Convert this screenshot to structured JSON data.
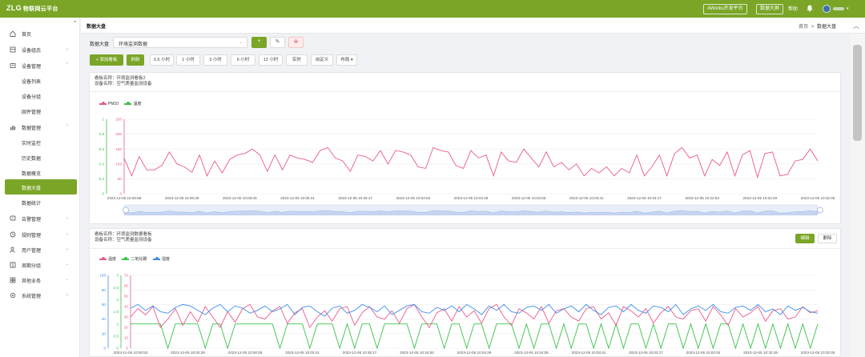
{
  "header": {
    "logo": "ZLG",
    "app_name": "物联网云平台",
    "dev_platform_btn": "AWorks开发平台",
    "big_screen_btn": "数据大屏",
    "help": "帮助"
  },
  "sidebar": {
    "items": [
      {
        "label": "首页",
        "icon": "home-icon"
      },
      {
        "label": "设备组态",
        "icon": "config-icon",
        "chevron": "⌄"
      },
      {
        "label": "设备管理",
        "icon": "device-icon",
        "chevron": "⌃"
      },
      {
        "label": "设备列表"
      },
      {
        "label": "设备分组"
      },
      {
        "label": "固件管理"
      },
      {
        "label": "数据管理",
        "icon": "bar-chart-icon",
        "chevron": "⌃"
      },
      {
        "label": "实时监控"
      },
      {
        "label": "历史数据"
      },
      {
        "label": "数据概览"
      },
      {
        "label": "数据大盘",
        "active": true
      },
      {
        "label": "数据统计"
      },
      {
        "label": "告警管理",
        "icon": "alarm-icon",
        "chevron": "⌄"
      },
      {
        "label": "规则管理",
        "icon": "clock-icon",
        "chevron": "⌄"
      },
      {
        "label": "用户管理",
        "icon": "user-icon",
        "chevron": "⌄"
      },
      {
        "label": "周期分组",
        "icon": "group-icon",
        "chevron": "⌄"
      },
      {
        "label": "其他业务",
        "icon": "app-icon",
        "chevron": "⌄"
      },
      {
        "label": "系统管理",
        "icon": "gear-icon",
        "chevron": "⌄"
      }
    ]
  },
  "page": {
    "title": "数据大盘",
    "breadcrumb_home": "首页",
    "breadcrumb_sep": ">",
    "breadcrumb_current": "数据大盘"
  },
  "toolbar": {
    "board_label": "数据大盘",
    "board_value": "环境监测数据",
    "add_btn": "+",
    "edit_btn": "✎",
    "delete_btn": "⊗",
    "add_chart_btn": "+ 添加看板",
    "refresh_btn": "刷新",
    "ranges": [
      "0.5 小时",
      "1 小时",
      "3 小时",
      "6 小时",
      "12 小时",
      "实时",
      "自定义",
      "布局 ▾"
    ]
  },
  "cards": [
    {
      "name_line": "看板名称：环境监测看板2",
      "group_line": "设备名称：空气质量监测设备",
      "chart_data": {
        "type": "line",
        "series": [
          {
            "name": "PM10",
            "color": "#e85a8b"
          },
          {
            "name": "温度",
            "color": "#38c24a"
          }
        ],
        "y_left": {
          "ticks": [
            "0",
            "0.2",
            "0.4",
            "0.6",
            "0.8",
            "1"
          ],
          "color": "#38c24a"
        },
        "y_inner": {
          "ticks": [
            "0",
            "50",
            "100",
            "150",
            "200",
            "250"
          ],
          "color": "#e85a8b"
        },
        "x_ticks": [
          "2023-12-05 10:00:58",
          "2023-12-05 10:00:29",
          "2023-12-05 10:06:05",
          "2023-12-05 10:05:41",
          "2023-12-05 10:25:17",
          "2023-12-05 10:04:53",
          "2023-12-05 10:04:29",
          "2023-12-05 10:04:05",
          "2023-12-05 10:03:41",
          "2023-12-05 10:03:17",
          "2023-12-05 10:22:53",
          "2023-12-05 10:32:29",
          "2023-12-05 10:32:05"
        ],
        "pm10_values": [
          120,
          60,
          125,
          80,
          80,
          95,
          140,
          100,
          90,
          72,
          130,
          60,
          110,
          70,
          115,
          130,
          135,
          150,
          130,
          75,
          130,
          80,
          130,
          120,
          115,
          105,
          145,
          155,
          120,
          110,
          75,
          130,
          125,
          110,
          145,
          100,
          145,
          140,
          130,
          90,
          85,
          155,
          145,
          140,
          95,
          85,
          145,
          120,
          130,
          60,
          140,
          110,
          105,
          150,
          120,
          90,
          140,
          90,
          105,
          80,
          100,
          60,
          85,
          70,
          90,
          60,
          85,
          70,
          130,
          60,
          90,
          130,
          60,
          135,
          155,
          120,
          130,
          60,
          115,
          95,
          140,
          60,
          130,
          145,
          55,
          135,
          140,
          60,
          65,
          110,
          115,
          150,
          110
        ]
      }
    },
    {
      "name_line": "看板名称：环境监测数据看板",
      "group_line": "设备名称：空气质量监测设备",
      "edit_label": "编辑",
      "delete_label": "删除",
      "chart_data": {
        "type": "line",
        "series": [
          {
            "name": "温度",
            "color": "#e85a8b"
          },
          {
            "name": "二氧化碳",
            "color": "#38c24a"
          },
          {
            "name": "湿度",
            "color": "#3e8ee8"
          }
        ],
        "y_left": {
          "ticks": [
            "0",
            "20",
            "40",
            "60",
            "80",
            "100"
          ],
          "color": "#3e8ee8"
        },
        "y_mid": {
          "ticks": [
            "0",
            "0.5",
            "1",
            "1.5",
            "2",
            "2.5",
            "3"
          ],
          "color": "#38c24a"
        },
        "y_inner": {
          "ticks": [
            "0",
            "10",
            "20",
            "30",
            "40",
            "50",
            "60",
            "70"
          ],
          "color": "#e85a8b"
        },
        "x_ticks": [
          "2023-12-05 10:00:53",
          "2023-12-05 10:00:29",
          "2023-12-05 10:00:05",
          "2023-12-05 10:03:41",
          "2023-12-05 10:35:17",
          "2023-12-05 10:34:53",
          "2023-12-05 10:04:29",
          "2023-12-05 10:04:05",
          "2023-12-05 10:03:41",
          "2023-12-05 10:03:17",
          "2023-12-05 10:02:53",
          "2023-12-05 10:32:29",
          "2023-12-05 10:32:05"
        ],
        "temp_values": [
          30,
          38,
          32,
          40,
          20,
          28,
          38,
          22,
          35,
          25,
          40,
          30,
          20,
          35,
          25,
          38,
          42,
          30,
          28,
          36,
          40,
          24,
          34,
          38,
          20,
          30,
          36,
          26,
          38,
          40,
          22,
          34,
          40,
          30,
          28,
          36,
          24,
          38,
          42,
          30,
          20,
          34,
          38,
          26,
          40,
          30,
          36,
          24,
          38,
          42,
          30,
          22,
          38,
          34,
          28,
          40,
          24,
          36,
          38,
          30,
          26,
          38,
          40,
          28,
          34,
          22,
          40,
          36,
          30,
          38,
          24,
          34,
          40,
          30,
          28,
          36,
          38,
          26,
          40,
          32,
          22,
          38,
          30,
          34,
          40,
          26,
          36,
          38,
          28,
          30,
          40,
          34,
          36
        ],
        "co2_values": [
          1,
          1,
          1,
          1,
          1,
          0,
          1,
          1,
          1,
          1,
          0,
          1,
          1,
          0,
          1,
          1,
          1,
          1,
          1,
          1,
          0,
          1,
          1,
          1,
          0,
          1,
          1,
          1,
          0,
          1,
          0,
          1,
          1,
          0,
          1,
          1,
          1,
          1,
          0,
          1,
          1,
          1,
          0,
          1,
          1,
          0,
          1,
          1,
          0,
          1,
          1,
          1,
          0,
          1,
          0,
          1,
          1,
          0,
          1,
          0,
          1,
          1,
          0,
          1,
          0,
          1,
          0,
          1,
          1,
          0,
          1,
          0,
          1,
          1,
          0,
          1,
          0,
          1,
          0,
          1,
          1,
          0,
          1,
          0,
          1,
          0,
          1,
          0,
          1,
          0,
          1,
          0,
          1
        ],
        "humidity_values": [
          55,
          60,
          52,
          58,
          50,
          48,
          56,
          60,
          58,
          52,
          46,
          55,
          60,
          50,
          58,
          55,
          48,
          52,
          58,
          50,
          54,
          60,
          46,
          56,
          58,
          50,
          44,
          55,
          58,
          48,
          52,
          60,
          56,
          50,
          58,
          46,
          52,
          58,
          60,
          50,
          48,
          56,
          52,
          58,
          50,
          60,
          54,
          46,
          58,
          52,
          60,
          50,
          48,
          56,
          58,
          52,
          60,
          48,
          54,
          58,
          50,
          60,
          52,
          46,
          56,
          58,
          50,
          60,
          52,
          48,
          58,
          56,
          50,
          60,
          46,
          54,
          58,
          52,
          60,
          50,
          48,
          56,
          58,
          52,
          60,
          50,
          54,
          46,
          58,
          52,
          56,
          50,
          48
        ]
      }
    }
  ]
}
